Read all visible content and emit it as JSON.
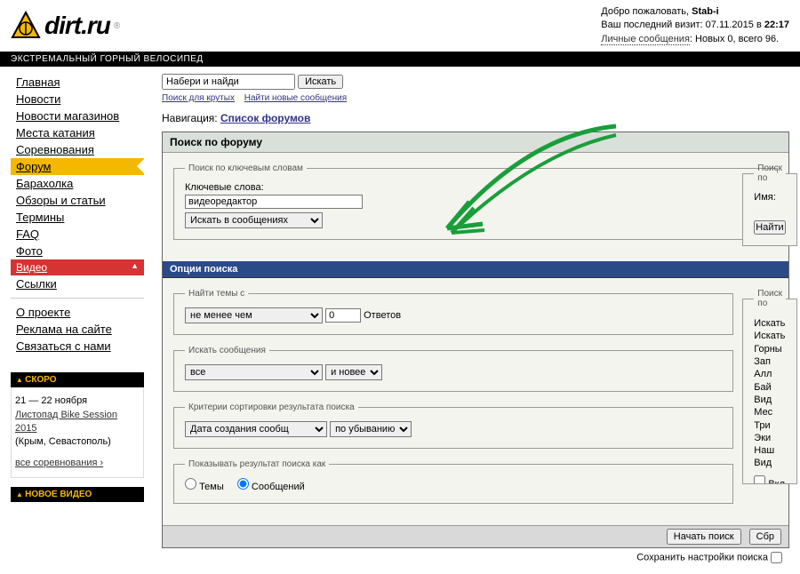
{
  "header": {
    "logo_text": "dirt.ru",
    "logo_reg": "®",
    "tagline": "ЭКСТРЕМАЛЬНЫЙ ГОРНЫЙ ВЕЛОСИПЕД",
    "welcome": "Добро пожаловать,",
    "username": "Stab-i",
    "last_visit_label": "Ваш последний визит:",
    "last_visit_date": "07.11.2015 в",
    "last_visit_time": "22:17",
    "pm_label": "Личные сообщения",
    "pm_value": ": Новых 0, всего 96."
  },
  "nav": {
    "items": [
      "Главная",
      "Новости",
      "Новости магазинов",
      "Места катания",
      "Соревнования",
      "Форум",
      "Барахолка",
      "Обзоры и статьи",
      "Термины",
      "FAQ",
      "Фото",
      "Видео",
      "Ссылки"
    ],
    "active_index": 5,
    "new_index": 11,
    "extra": [
      "О проекте",
      "Реклама на сайте",
      "Связаться с нами"
    ]
  },
  "soon_box": {
    "title": "СКОРО",
    "date": "21 — 22 ноября",
    "event": "Листопад Bike Session 2015",
    "place": "(Крым, Севастополь)",
    "all_link": "все соревнования ›"
  },
  "video_box": {
    "title": "НОВОЕ ВИДЕО"
  },
  "topsearch": {
    "placeholder": "Набери и найди",
    "button": "Искать",
    "link1": "Поиск для крутых",
    "link2": "Найти новые сообщения"
  },
  "breadcrumb": {
    "label": "Навигация:",
    "link": "Список форумов"
  },
  "panel": {
    "title": "Поиск по форуму",
    "kw_legend": "Поиск по ключевым словам",
    "kw_label": "Ключевые слова:",
    "kw_value": "видеоредактор",
    "kw_scope_selected": "Искать в сообщениях",
    "user_legend": "Поиск по",
    "user_label": "Имя:",
    "user_btn": "Найти",
    "options_title": "Опции поиска",
    "find_legend": "Найти темы с",
    "find_op": "не менее чем",
    "find_num": "0",
    "find_unit": "Ответов",
    "msgs_legend": "Искать сообщения",
    "msgs_scope": "все",
    "msgs_order": "и новее",
    "sort_legend": "Критерии сортировки результата поиска",
    "sort_field": "Дата создания сообщ",
    "sort_dir": "по убыванию",
    "show_legend": "Показывать результат поиска как",
    "show_r1": "Темы",
    "show_r2": "Сообщений",
    "cats_legend": "Поиск по",
    "cats": [
      "Искать",
      "Искать",
      "Горны",
      "  Зап",
      "Алл",
      "Бай",
      "Вид",
      "Мес",
      "Три",
      "Эки",
      "Наш",
      "Вид"
    ],
    "cats_incl": "Вкл",
    "btn_search": "Начать поиск",
    "btn_reset": "Сбр",
    "save_pref": "Сохранить настройки поиска"
  }
}
